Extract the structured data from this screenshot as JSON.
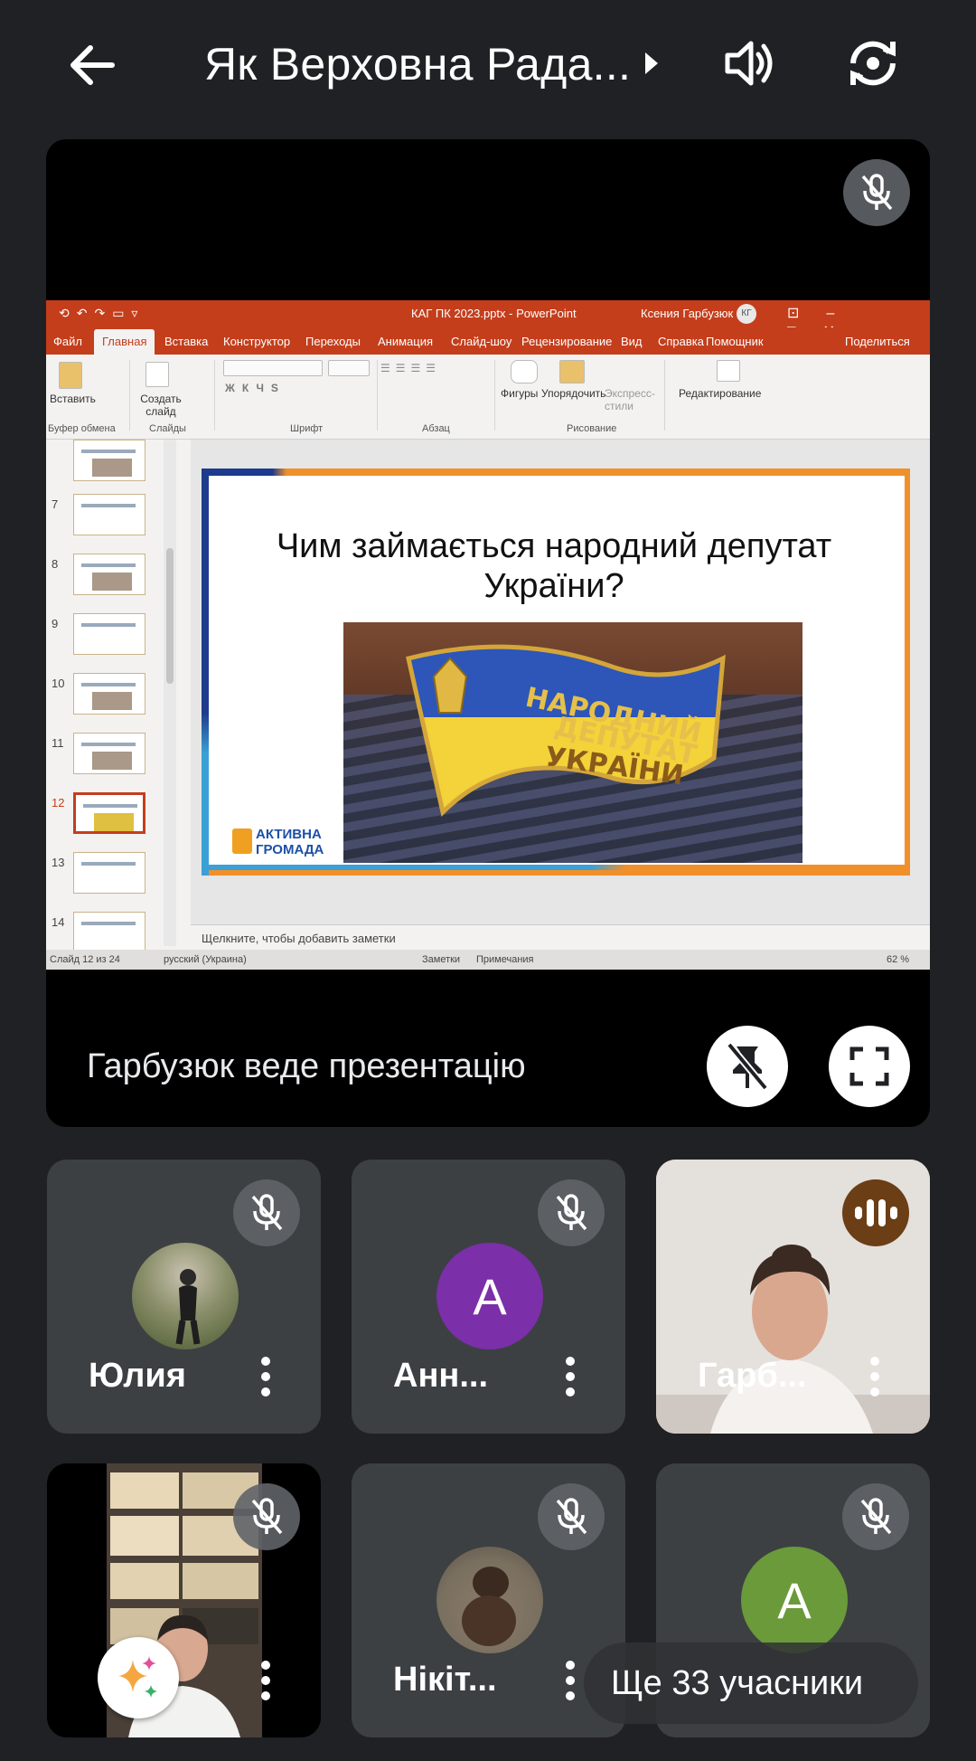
{
  "header": {
    "meeting_title": "Як Верховна Рада...",
    "icons": [
      "arrow-left-icon",
      "chevron-right-icon",
      "volume-icon",
      "switch-camera-icon"
    ]
  },
  "presentation": {
    "presenting_label": "Гарбузюк веде презентацію",
    "ppt": {
      "document_title": "КАГ ПК 2023.pptx  -  PowerPoint",
      "user_name": "Ксения Гарбузюк",
      "user_initials": "КГ",
      "menu": [
        "Файл",
        "Главная",
        "Вставка",
        "Конструктор",
        "Переходы",
        "Анимация",
        "Слайд-шоу",
        "Рецензирование",
        "Вид",
        "Справка",
        "Помощник",
        "Поделиться"
      ],
      "active_menu": "Главная",
      "ribbon": {
        "paste": "Вставить",
        "new_slide": "Создать слайд",
        "shapes": "Фигуры",
        "arrange": "Упорядочить",
        "quick_styles": "Экспресс-стили",
        "editing": "Редактирование",
        "groups": [
          "Буфер обмена",
          "Слайды",
          "Шрифт",
          "Абзац",
          "Рисование"
        ]
      },
      "thumbnails": [
        "7",
        "8",
        "9",
        "10",
        "11",
        "12",
        "13",
        "14"
      ],
      "selected_thumbnail": "12",
      "slide": {
        "title": "Чим займається народний депутат України?",
        "badge_text": [
          "НАРОДНИЙ",
          "ДЕПУТАТ",
          "УКРАЇНИ"
        ],
        "logo_line1": "АКТИВНА",
        "logo_line2": "ГРОМАДА"
      },
      "notes_placeholder": "Щелкните, чтобы добавить заметки",
      "status": {
        "slide_count": "Слайд 12 из 24",
        "language": "русский (Украина)",
        "notes": "Заметки",
        "comments": "Примечания",
        "zoom": "62 %"
      }
    }
  },
  "participants": [
    {
      "name": "Юлия",
      "muted": true,
      "avatar": "photo"
    },
    {
      "name": "Анн...",
      "muted": true,
      "avatar": "letter",
      "initial": "А",
      "color": "#7b2fa8"
    },
    {
      "name": "Гарб...",
      "muted": false,
      "speaking": true,
      "avatar": "video"
    },
    {
      "name": "",
      "muted": true,
      "avatar": "video"
    },
    {
      "name": "Нікіт...",
      "muted": true,
      "avatar": "photo"
    },
    {
      "name": "",
      "muted": true,
      "avatar": "letter",
      "initial": "А",
      "color": "#6a9a3a"
    }
  ],
  "more_participants_label": "Ще 33 учасники",
  "colors": {
    "background": "#202124",
    "tile": "#3c4043",
    "ppt_accent": "#c43e1c",
    "speaking_badge": "#6b3e16"
  }
}
